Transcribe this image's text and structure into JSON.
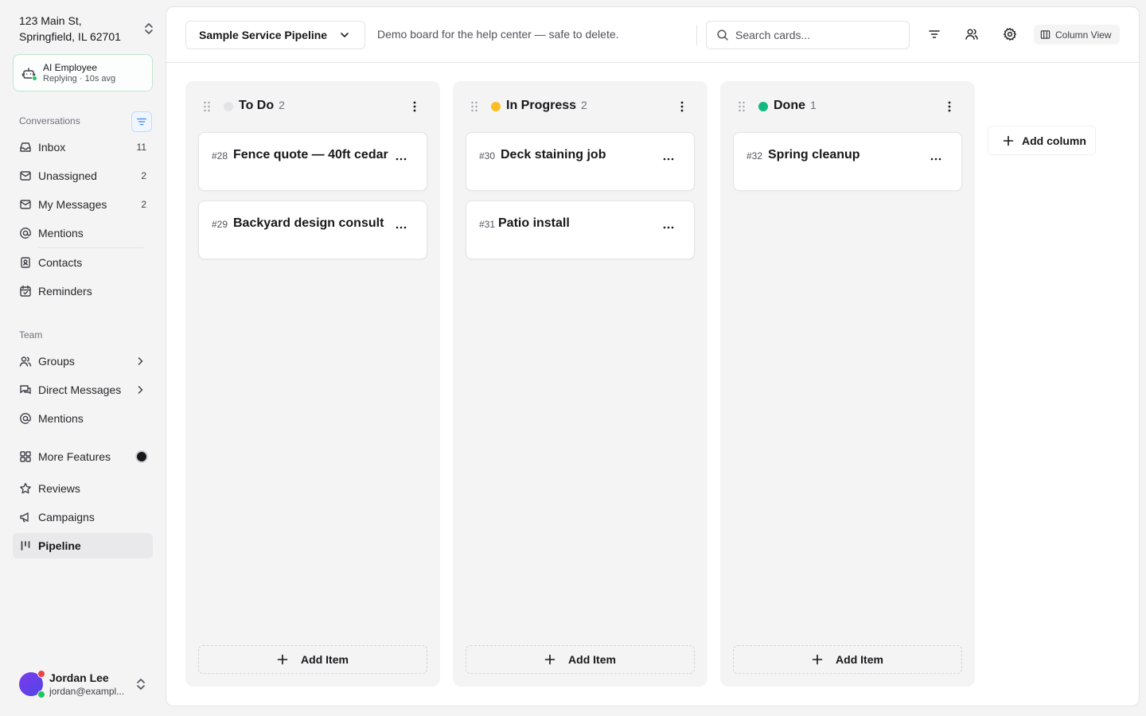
{
  "sidebar": {
    "location": "123 Main St, Springfield, IL 62701",
    "ai": {
      "title": "AI Employee",
      "status": "Replying · 10s avg"
    },
    "conversations_label": "Conversations",
    "conversations": [
      {
        "label": "Inbox",
        "count": "11",
        "icon": "inbox-icon"
      },
      {
        "label": "Unassigned",
        "count": "2",
        "icon": "mail-unassigned-icon"
      },
      {
        "label": "My Messages",
        "count": "2",
        "icon": "mail-icon"
      },
      {
        "label": "Mentions",
        "count": "",
        "icon": "at-icon"
      },
      {
        "label": "Contacts",
        "count": "",
        "icon": "contact-book-icon"
      },
      {
        "label": "Reminders",
        "count": "",
        "icon": "calendar-check-icon"
      }
    ],
    "team_label": "Team",
    "team": [
      {
        "label": "Groups",
        "icon": "users-icon"
      },
      {
        "label": "Direct Messages",
        "icon": "chat-icon"
      },
      {
        "label": "Mentions",
        "icon": "at-icon"
      }
    ],
    "more": [
      {
        "label": "More Features",
        "icon": "grid-icon"
      },
      {
        "label": "Reviews",
        "icon": "star-icon"
      },
      {
        "label": "Campaigns",
        "icon": "megaphone-icon"
      },
      {
        "label": "Pipeline",
        "icon": "pipeline-icon",
        "active": true
      }
    ],
    "user": {
      "name": "Jordan Lee",
      "email": "jordan@exampl..."
    }
  },
  "topbar": {
    "board_name": "Sample Service Pipeline",
    "description": "Demo board for the help center — safe to delete.",
    "search_placeholder": "Search cards...",
    "view_label": "Column View"
  },
  "board": {
    "columns": [
      {
        "title": "To Do",
        "count": "2",
        "color": "#e4e4e7",
        "cards": [
          {
            "id": "#28",
            "title": "Fence quote — 40ft cedar"
          },
          {
            "id": "#29",
            "title": "Backyard design consult"
          }
        ],
        "add_label": "Add Item"
      },
      {
        "title": "In Progress",
        "count": "2",
        "color": "#fbbf24",
        "cards": [
          {
            "id": "#30",
            "title": "Deck staining job"
          },
          {
            "id": "#31",
            "title": "Patio install"
          }
        ],
        "add_label": "Add Item"
      },
      {
        "title": "Done",
        "count": "1",
        "color": "#10b981",
        "cards": [
          {
            "id": "#32",
            "title": "Spring cleanup"
          }
        ],
        "add_label": "Add Item"
      }
    ],
    "add_column_label": "Add column"
  }
}
